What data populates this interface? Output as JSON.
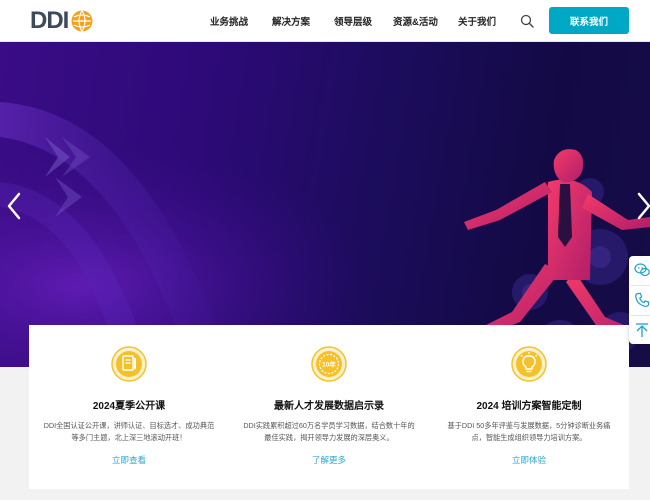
{
  "header": {
    "logo_text": "DDI",
    "nav": [
      "业务挑战",
      "解决方案",
      "领导层级",
      "资源&活动",
      "关于我们"
    ],
    "contact_label": "联系我们"
  },
  "colors": {
    "accent": "#00a8c6",
    "logo_orange": "#f3a21c",
    "link": "#2aa6d0",
    "icon_yellow": "#f5c12b"
  },
  "cards": [
    {
      "icon": "notebook-icon",
      "title": "2024夏季公开课",
      "desc": "DDI全国认证公开课，讲师认证、目标选才、成功典范等多门主题，北上深三地滚动开班！",
      "link": "立即查看"
    },
    {
      "icon": "ten-year-badge-icon",
      "badge": "10年",
      "title": "最新人才发展数据启示录",
      "desc": "DDI实践累积超过60万名学员学习数据，结合数十年的最佳实践，揭开领导力发展的深层奥义。",
      "link": "了解更多"
    },
    {
      "icon": "lightbulb-icon",
      "title": "2024 培训方案智能定制",
      "desc": "基于DDI 50多年评鉴与发展数据，5分钟诊断业务痛点，智能生成组织领导力培训方案。",
      "link": "立即体验"
    }
  ]
}
